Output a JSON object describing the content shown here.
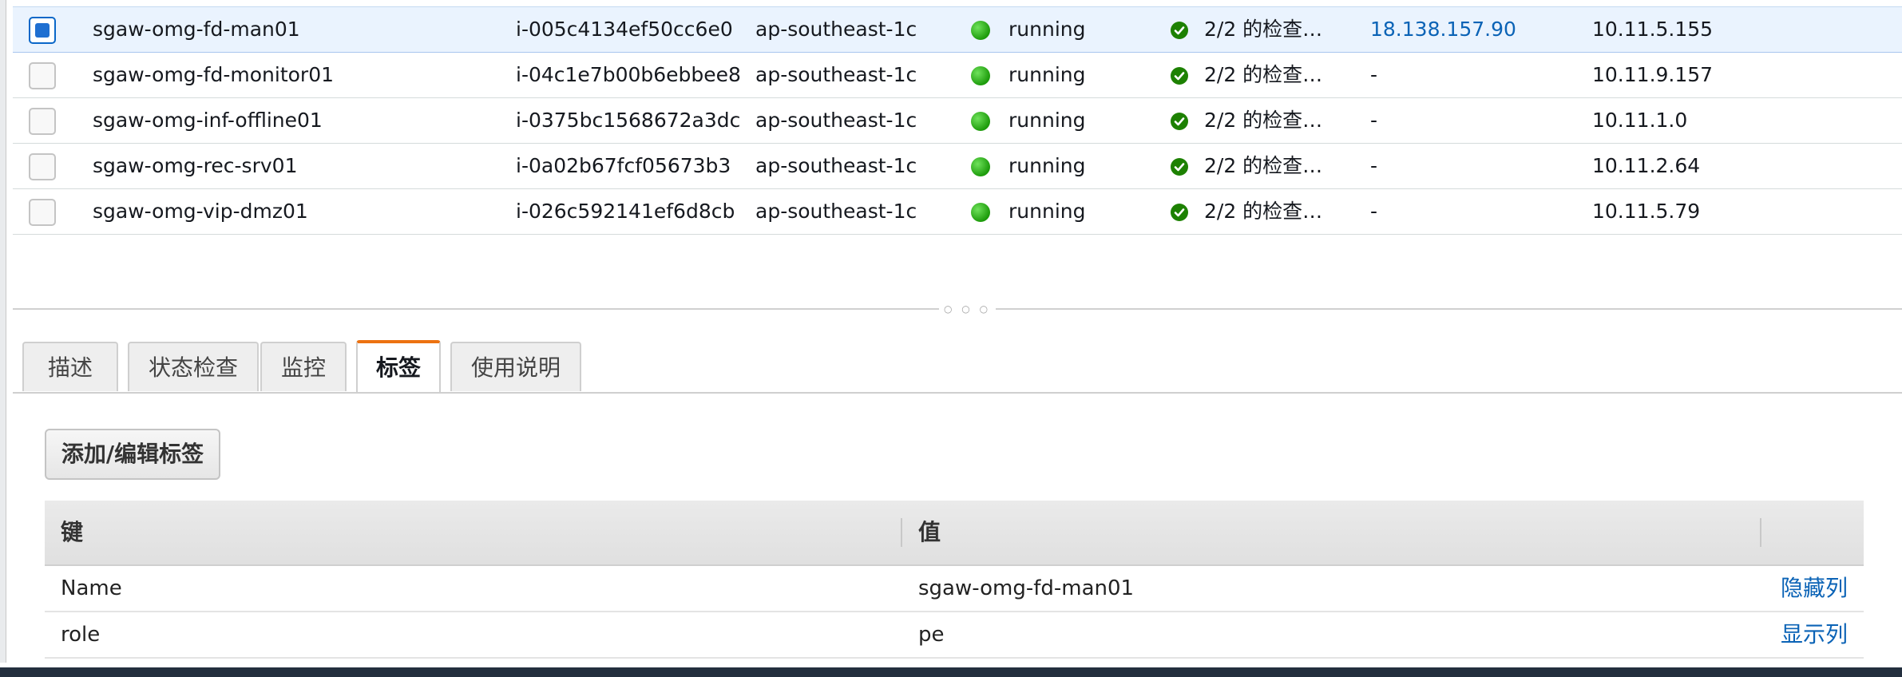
{
  "instances": [
    {
      "name": "sgaw-omg-fd-man01",
      "id": "i-005c4134ef50cc6e0",
      "az": "ap-southeast-1c",
      "state": "running",
      "status_checks": "2/2 的检查…",
      "public_ip": "18.138.157.90",
      "private_ip": "10.11.5.155",
      "selected": true
    },
    {
      "name": "sgaw-omg-fd-monitor01",
      "id": "i-04c1e7b00b6ebbee8",
      "az": "ap-southeast-1c",
      "state": "running",
      "status_checks": "2/2 的检查…",
      "public_ip": "-",
      "private_ip": "10.11.9.157",
      "selected": false
    },
    {
      "name": "sgaw-omg-inf-offline01",
      "id": "i-0375bc1568672a3dc",
      "az": "ap-southeast-1c",
      "state": "running",
      "status_checks": "2/2 的检查…",
      "public_ip": "-",
      "private_ip": "10.11.1.0",
      "selected": false
    },
    {
      "name": "sgaw-omg-rec-srv01",
      "id": "i-0a02b67fcf05673b3",
      "az": "ap-southeast-1c",
      "state": "running",
      "status_checks": "2/2 的检查…",
      "public_ip": "-",
      "private_ip": "10.11.2.64",
      "selected": false
    },
    {
      "name": "sgaw-omg-vip-dmz01",
      "id": "i-026c592141ef6d8cb",
      "az": "ap-southeast-1c",
      "state": "running",
      "status_checks": "2/2 的检查…",
      "public_ip": "-",
      "private_ip": "10.11.5.79",
      "selected": false
    }
  ],
  "splitter": {
    "grip": "○ ○ ○"
  },
  "tabs": [
    {
      "label": "描述",
      "active": false
    },
    {
      "label": "状态检查",
      "active": false
    },
    {
      "label": "监控",
      "active": false
    },
    {
      "label": "标签",
      "active": true
    },
    {
      "label": "使用说明",
      "active": false
    }
  ],
  "tags_panel": {
    "add_button": "添加/编辑标签",
    "columns": {
      "key": "键",
      "value": "值"
    },
    "rows": [
      {
        "key": "Name",
        "value": "sgaw-omg-fd-man01",
        "action": "隐藏列"
      },
      {
        "key": "role",
        "value": "pe",
        "action": "显示列"
      }
    ]
  },
  "colors": {
    "accent_tab": "#ec7211",
    "link": "#0b63b6",
    "running": "#1d9b0b",
    "selected_row": "#eaf3fe"
  }
}
